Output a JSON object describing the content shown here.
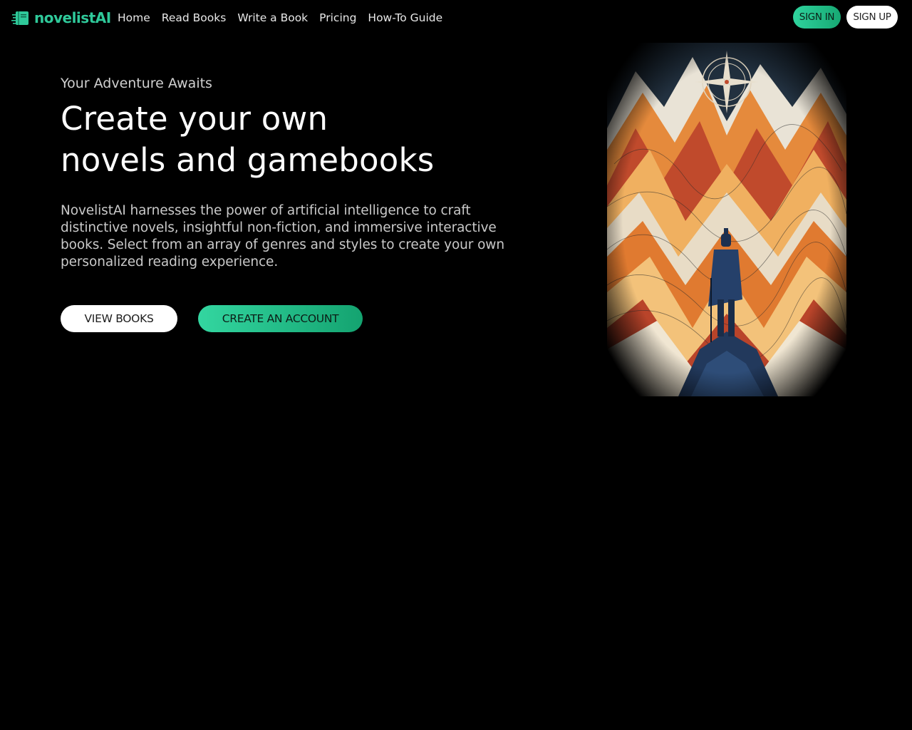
{
  "nav": {
    "brand": "novelistAI",
    "links": [
      {
        "label": "Home"
      },
      {
        "label": "Read Books"
      },
      {
        "label": "Write a Book"
      },
      {
        "label": "Pricing"
      },
      {
        "label": "How-To Guide"
      }
    ],
    "sign_in": "SIGN IN",
    "sign_up": "SIGN UP"
  },
  "hero": {
    "eyebrow": "Your Adventure Awaits",
    "title_line1": "Create your own",
    "title_line2": "novels and gamebooks",
    "description": "NovelistAI harnesses the power of artificial intelligence to craft distinctive novels, insightful non-fiction, and immersive interactive books. Select from an array of genres and styles to create your own personalized reading experience.",
    "view_books": "VIEW BOOKS",
    "create_account": "CREATE AN ACCOUNT"
  },
  "colors": {
    "background": "#000000",
    "brand_green": "#2fc99a",
    "button_green_start": "#33d6a0",
    "button_green_end": "#14a370"
  },
  "icons": {
    "logo": "book-stack-logo-icon",
    "compass": "compass-rose-icon"
  }
}
